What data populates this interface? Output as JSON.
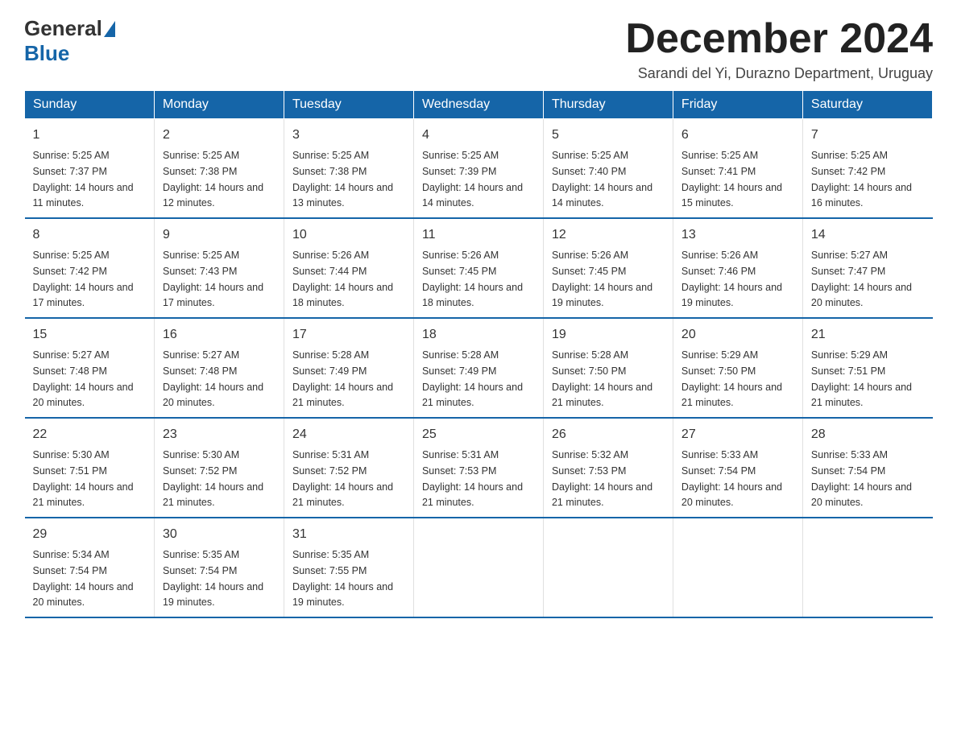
{
  "logo": {
    "general": "General",
    "blue": "Blue",
    "underline": "Blue"
  },
  "header": {
    "month_title": "December 2024",
    "subtitle": "Sarandi del Yi, Durazno Department, Uruguay"
  },
  "weekdays": [
    "Sunday",
    "Monday",
    "Tuesday",
    "Wednesday",
    "Thursday",
    "Friday",
    "Saturday"
  ],
  "weeks": [
    [
      {
        "day": "1",
        "sunrise": "5:25 AM",
        "sunset": "7:37 PM",
        "daylight": "14 hours and 11 minutes."
      },
      {
        "day": "2",
        "sunrise": "5:25 AM",
        "sunset": "7:38 PM",
        "daylight": "14 hours and 12 minutes."
      },
      {
        "day": "3",
        "sunrise": "5:25 AM",
        "sunset": "7:38 PM",
        "daylight": "14 hours and 13 minutes."
      },
      {
        "day": "4",
        "sunrise": "5:25 AM",
        "sunset": "7:39 PM",
        "daylight": "14 hours and 14 minutes."
      },
      {
        "day": "5",
        "sunrise": "5:25 AM",
        "sunset": "7:40 PM",
        "daylight": "14 hours and 14 minutes."
      },
      {
        "day": "6",
        "sunrise": "5:25 AM",
        "sunset": "7:41 PM",
        "daylight": "14 hours and 15 minutes."
      },
      {
        "day": "7",
        "sunrise": "5:25 AM",
        "sunset": "7:42 PM",
        "daylight": "14 hours and 16 minutes."
      }
    ],
    [
      {
        "day": "8",
        "sunrise": "5:25 AM",
        "sunset": "7:42 PM",
        "daylight": "14 hours and 17 minutes."
      },
      {
        "day": "9",
        "sunrise": "5:25 AM",
        "sunset": "7:43 PM",
        "daylight": "14 hours and 17 minutes."
      },
      {
        "day": "10",
        "sunrise": "5:26 AM",
        "sunset": "7:44 PM",
        "daylight": "14 hours and 18 minutes."
      },
      {
        "day": "11",
        "sunrise": "5:26 AM",
        "sunset": "7:45 PM",
        "daylight": "14 hours and 18 minutes."
      },
      {
        "day": "12",
        "sunrise": "5:26 AM",
        "sunset": "7:45 PM",
        "daylight": "14 hours and 19 minutes."
      },
      {
        "day": "13",
        "sunrise": "5:26 AM",
        "sunset": "7:46 PM",
        "daylight": "14 hours and 19 minutes."
      },
      {
        "day": "14",
        "sunrise": "5:27 AM",
        "sunset": "7:47 PM",
        "daylight": "14 hours and 20 minutes."
      }
    ],
    [
      {
        "day": "15",
        "sunrise": "5:27 AM",
        "sunset": "7:48 PM",
        "daylight": "14 hours and 20 minutes."
      },
      {
        "day": "16",
        "sunrise": "5:27 AM",
        "sunset": "7:48 PM",
        "daylight": "14 hours and 20 minutes."
      },
      {
        "day": "17",
        "sunrise": "5:28 AM",
        "sunset": "7:49 PM",
        "daylight": "14 hours and 21 minutes."
      },
      {
        "day": "18",
        "sunrise": "5:28 AM",
        "sunset": "7:49 PM",
        "daylight": "14 hours and 21 minutes."
      },
      {
        "day": "19",
        "sunrise": "5:28 AM",
        "sunset": "7:50 PM",
        "daylight": "14 hours and 21 minutes."
      },
      {
        "day": "20",
        "sunrise": "5:29 AM",
        "sunset": "7:50 PM",
        "daylight": "14 hours and 21 minutes."
      },
      {
        "day": "21",
        "sunrise": "5:29 AM",
        "sunset": "7:51 PM",
        "daylight": "14 hours and 21 minutes."
      }
    ],
    [
      {
        "day": "22",
        "sunrise": "5:30 AM",
        "sunset": "7:51 PM",
        "daylight": "14 hours and 21 minutes."
      },
      {
        "day": "23",
        "sunrise": "5:30 AM",
        "sunset": "7:52 PM",
        "daylight": "14 hours and 21 minutes."
      },
      {
        "day": "24",
        "sunrise": "5:31 AM",
        "sunset": "7:52 PM",
        "daylight": "14 hours and 21 minutes."
      },
      {
        "day": "25",
        "sunrise": "5:31 AM",
        "sunset": "7:53 PM",
        "daylight": "14 hours and 21 minutes."
      },
      {
        "day": "26",
        "sunrise": "5:32 AM",
        "sunset": "7:53 PM",
        "daylight": "14 hours and 21 minutes."
      },
      {
        "day": "27",
        "sunrise": "5:33 AM",
        "sunset": "7:54 PM",
        "daylight": "14 hours and 20 minutes."
      },
      {
        "day": "28",
        "sunrise": "5:33 AM",
        "sunset": "7:54 PM",
        "daylight": "14 hours and 20 minutes."
      }
    ],
    [
      {
        "day": "29",
        "sunrise": "5:34 AM",
        "sunset": "7:54 PM",
        "daylight": "14 hours and 20 minutes."
      },
      {
        "day": "30",
        "sunrise": "5:35 AM",
        "sunset": "7:54 PM",
        "daylight": "14 hours and 19 minutes."
      },
      {
        "day": "31",
        "sunrise": "5:35 AM",
        "sunset": "7:55 PM",
        "daylight": "14 hours and 19 minutes."
      },
      null,
      null,
      null,
      null
    ]
  ],
  "labels": {
    "sunrise": "Sunrise:",
    "sunset": "Sunset:",
    "daylight": "Daylight:"
  }
}
